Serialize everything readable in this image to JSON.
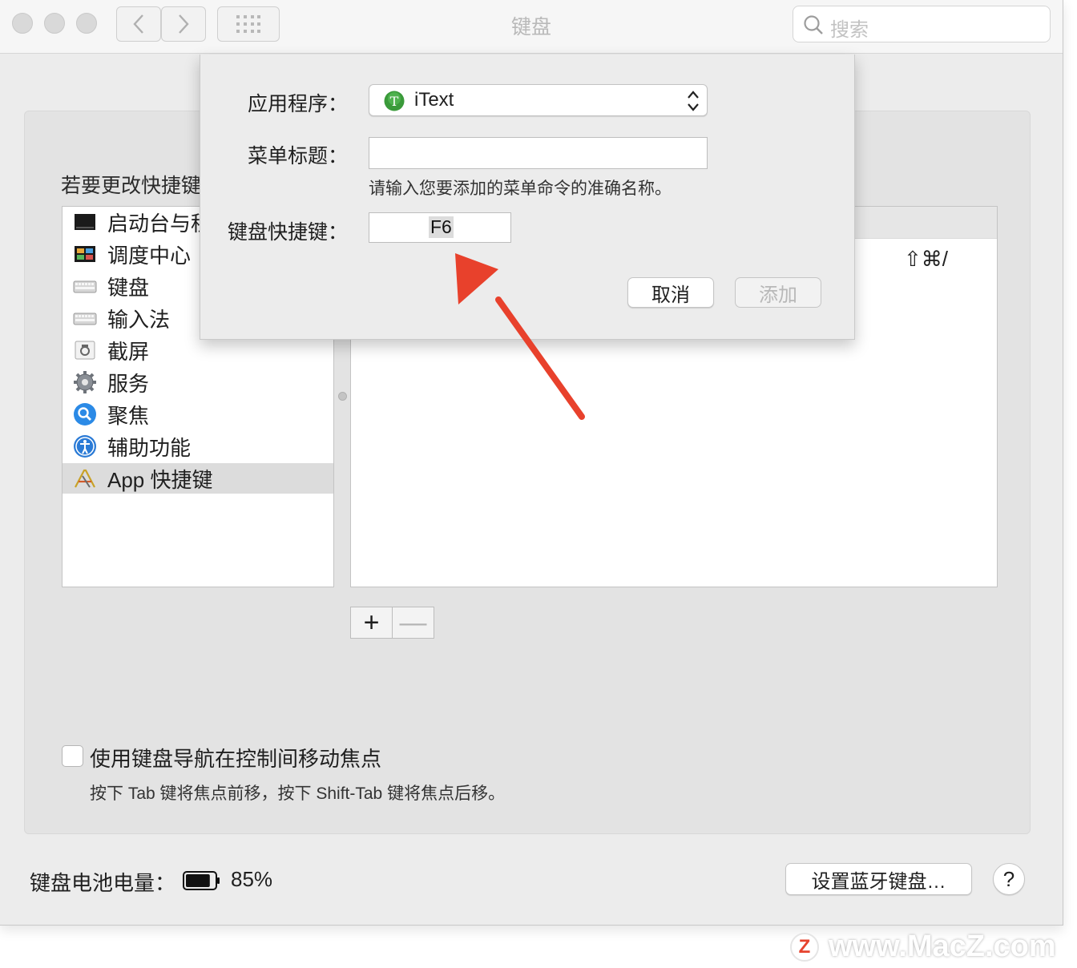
{
  "window": {
    "title": "键盘"
  },
  "search": {
    "placeholder": "搜索"
  },
  "panel": {
    "instruction": "若要更改快捷键",
    "categories": [
      {
        "label": "启动台与程",
        "icon": "launchpad-icon"
      },
      {
        "label": "调度中心",
        "icon": "mission-control-icon"
      },
      {
        "label": "键盘",
        "icon": "keyboard-icon"
      },
      {
        "label": "输入法",
        "icon": "input-source-icon"
      },
      {
        "label": "截屏",
        "icon": "screenshot-icon"
      },
      {
        "label": "服务",
        "icon": "gear-icon"
      },
      {
        "label": "聚焦",
        "icon": "spotlight-icon"
      },
      {
        "label": "辅助功能",
        "icon": "accessibility-icon"
      },
      {
        "label": "App 快捷键",
        "icon": "app-store-icon"
      }
    ],
    "selected_index": 8,
    "shortcut_row": {
      "shortcut": "⇧⌘/"
    },
    "add_label": "+",
    "remove_label": "—"
  },
  "footer": {
    "checkbox_label": "使用键盘导航在控制间移动焦点",
    "checkbox_help": "按下 Tab 键将焦点前移，按下 Shift-Tab 键将焦点后移。",
    "battery_label": "键盘电池电量：",
    "battery_value": "85%",
    "battery_level": 0.85,
    "bluetooth_button": "设置蓝牙键盘…",
    "help_button": "?"
  },
  "sheet": {
    "app_label": "应用程序：",
    "app_value": "iText",
    "menu_title_label": "菜单标题：",
    "menu_title_value": "",
    "hint": "请输入您要添加的菜单命令的准确名称。",
    "shortcut_label": "键盘快捷键：",
    "shortcut_value": "F6",
    "cancel": "取消",
    "add": "添加"
  },
  "watermark": {
    "logo_letter": "Z",
    "text": "www.MacZ.com"
  },
  "colors": {
    "arrow": "#e8412c",
    "app_icon": "#3a9a3a",
    "watermark_logo": "#e6432e"
  }
}
